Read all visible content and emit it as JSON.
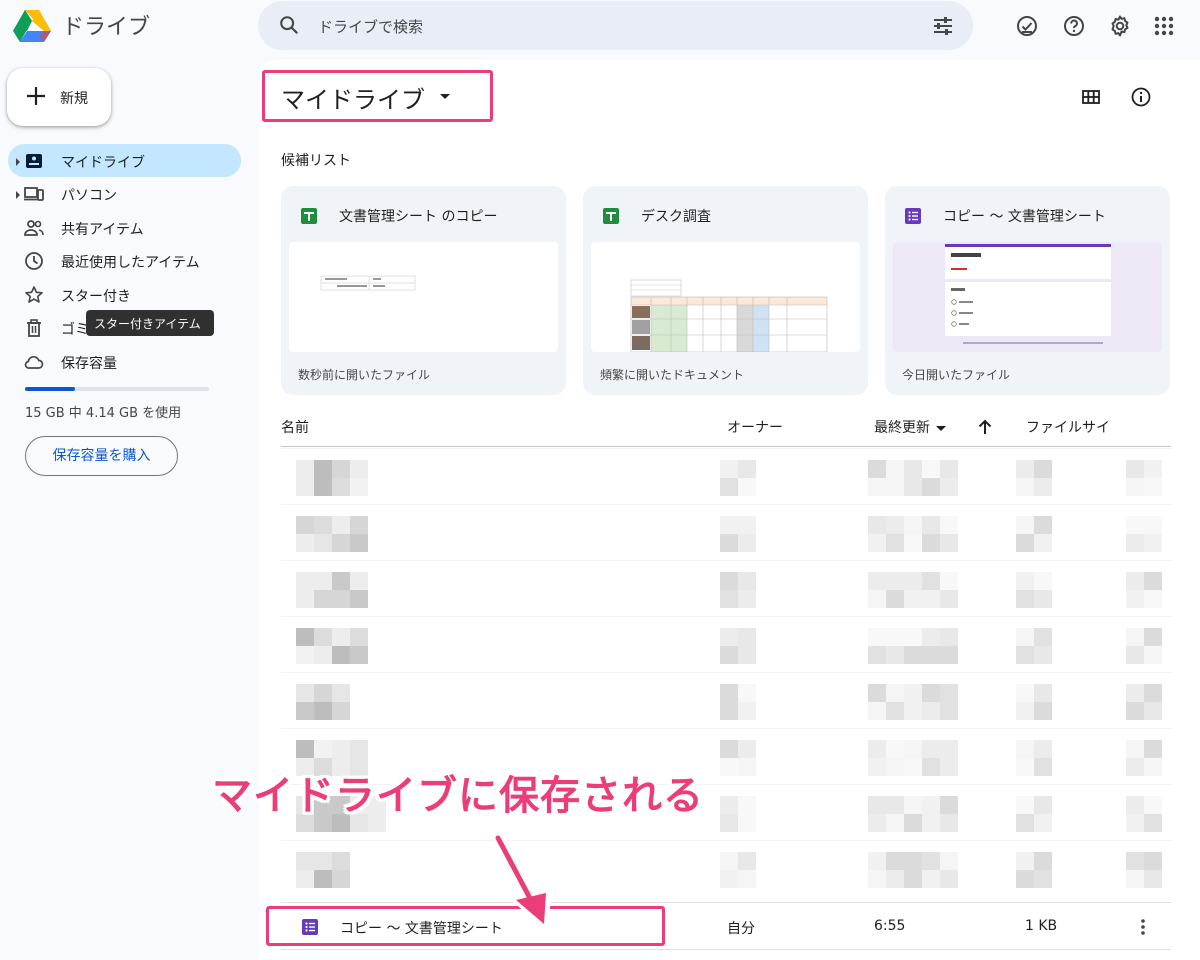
{
  "app": {
    "name": "ドライブ",
    "search_placeholder": "ドライブで検索"
  },
  "sidebar": {
    "new_label": "新規",
    "items": [
      {
        "label": "マイドライブ",
        "icon": "my-drive-icon",
        "active": true
      },
      {
        "label": "パソコン",
        "icon": "computers-icon"
      },
      {
        "label": "共有アイテム",
        "icon": "shared-icon"
      },
      {
        "label": "最近使用したアイテム",
        "icon": "recent-clock-icon"
      },
      {
        "label": "スター付き",
        "icon": "star-icon"
      },
      {
        "label": "ゴミ",
        "icon": "trash-icon"
      },
      {
        "label": "保存容量",
        "icon": "cloud-icon"
      }
    ],
    "tooltip": "スター付きアイテム",
    "storage_used_fraction": 0.27,
    "storage_text": "15 GB 中 4.14 GB を使用",
    "buy_label": "保存容量を購入"
  },
  "main": {
    "title": "マイドライブ",
    "suggested_label": "候補リスト",
    "cards": [
      {
        "title": "文書管理シート のコピー",
        "icon": "sheets-icon",
        "footer": "数秒前に開いたファイル"
      },
      {
        "title": "デスク調査",
        "icon": "sheets-icon",
        "footer": "頻繁に開いたドキュメント"
      },
      {
        "title": "コピー 〜 文書管理シート",
        "icon": "forms-icon",
        "footer": "今日開いたファイル"
      }
    ],
    "columns": {
      "name": "名前",
      "owner": "オーナー",
      "modified": "最終更新",
      "size": "ファイルサイ"
    },
    "file": {
      "name": "コピー 〜 文書管理シート",
      "owner": "自分",
      "modified": "6:55",
      "size": "1 KB"
    }
  },
  "annotation": "マイドライブに保存される",
  "colors": {
    "accent": "#ea3d7a",
    "active_nav": "#c2e7ff",
    "link": "#0b57d0"
  }
}
